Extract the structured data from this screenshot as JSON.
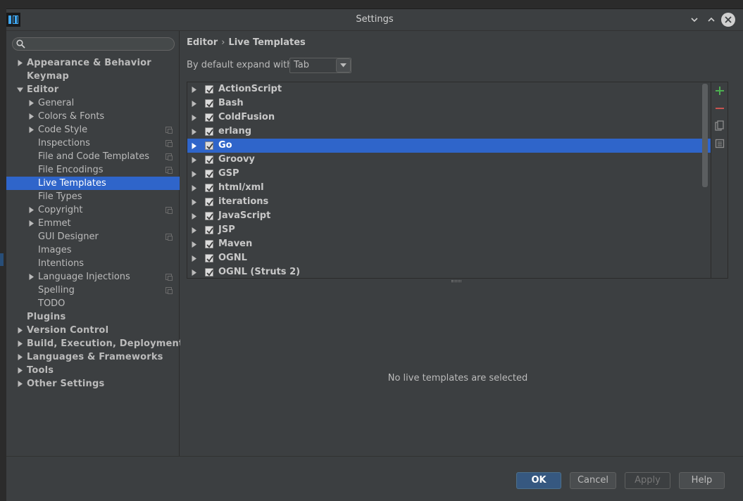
{
  "window": {
    "title": "Settings"
  },
  "search": {
    "placeholder": ""
  },
  "sidebar": {
    "items": [
      {
        "label": "Appearance & Behavior",
        "level": 0,
        "bold": true,
        "arrow": "right"
      },
      {
        "label": "Keymap",
        "level": 0,
        "bold": true,
        "arrow": "none"
      },
      {
        "label": "Editor",
        "level": 0,
        "bold": true,
        "arrow": "down"
      },
      {
        "label": "General",
        "level": 1,
        "bold": false,
        "arrow": "right"
      },
      {
        "label": "Colors & Fonts",
        "level": 1,
        "bold": false,
        "arrow": "right"
      },
      {
        "label": "Code Style",
        "level": 1,
        "bold": false,
        "arrow": "right",
        "project": true
      },
      {
        "label": "Inspections",
        "level": 1,
        "bold": false,
        "arrow": "none",
        "project": true
      },
      {
        "label": "File and Code Templates",
        "level": 1,
        "bold": false,
        "arrow": "none",
        "project": true
      },
      {
        "label": "File Encodings",
        "level": 1,
        "bold": false,
        "arrow": "none",
        "project": true
      },
      {
        "label": "Live Templates",
        "level": 1,
        "bold": false,
        "arrow": "none",
        "selected": true
      },
      {
        "label": "File Types",
        "level": 1,
        "bold": false,
        "arrow": "none"
      },
      {
        "label": "Copyright",
        "level": 1,
        "bold": false,
        "arrow": "right",
        "project": true
      },
      {
        "label": "Emmet",
        "level": 1,
        "bold": false,
        "arrow": "right"
      },
      {
        "label": "GUI Designer",
        "level": 1,
        "bold": false,
        "arrow": "none",
        "project": true
      },
      {
        "label": "Images",
        "level": 1,
        "bold": false,
        "arrow": "none"
      },
      {
        "label": "Intentions",
        "level": 1,
        "bold": false,
        "arrow": "none"
      },
      {
        "label": "Language Injections",
        "level": 1,
        "bold": false,
        "arrow": "right",
        "project": true
      },
      {
        "label": "Spelling",
        "level": 1,
        "bold": false,
        "arrow": "none",
        "project": true
      },
      {
        "label": "TODO",
        "level": 1,
        "bold": false,
        "arrow": "none"
      },
      {
        "label": "Plugins",
        "level": 0,
        "bold": true,
        "arrow": "none"
      },
      {
        "label": "Version Control",
        "level": 0,
        "bold": true,
        "arrow": "right"
      },
      {
        "label": "Build, Execution, Deployment",
        "level": 0,
        "bold": true,
        "arrow": "right"
      },
      {
        "label": "Languages & Frameworks",
        "level": 0,
        "bold": true,
        "arrow": "right"
      },
      {
        "label": "Tools",
        "level": 0,
        "bold": true,
        "arrow": "right"
      },
      {
        "label": "Other Settings",
        "level": 0,
        "bold": true,
        "arrow": "right"
      }
    ]
  },
  "content": {
    "breadcrumb": [
      "Editor",
      "Live Templates"
    ],
    "breadcrumb_sep": "›",
    "expand_label": "By default expand with",
    "expand_value": "Tab",
    "templates": [
      {
        "name": "ActionScript",
        "checked": true
      },
      {
        "name": "Bash",
        "checked": true
      },
      {
        "name": "ColdFusion",
        "checked": true
      },
      {
        "name": "erlang",
        "checked": true
      },
      {
        "name": "Go",
        "checked": true,
        "selected": true
      },
      {
        "name": "Groovy",
        "checked": true
      },
      {
        "name": "GSP",
        "checked": true
      },
      {
        "name": "html/xml",
        "checked": true
      },
      {
        "name": "iterations",
        "checked": true
      },
      {
        "name": "JavaScript",
        "checked": true
      },
      {
        "name": "JSP",
        "checked": true
      },
      {
        "name": "Maven",
        "checked": true
      },
      {
        "name": "OGNL",
        "checked": true
      },
      {
        "name": "OGNL (Struts 2)",
        "checked": true
      }
    ],
    "empty_message": "No live templates are selected"
  },
  "footer": {
    "ok": "OK",
    "cancel": "Cancel",
    "apply": "Apply",
    "help": "Help"
  },
  "colors": {
    "selection": "#2f65ca",
    "add": "#4caf50",
    "remove": "#c75450"
  }
}
